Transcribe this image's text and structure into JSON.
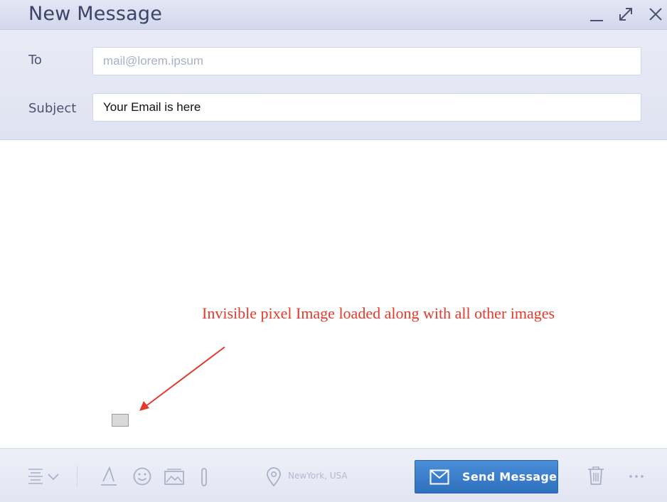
{
  "window": {
    "title": "New Message"
  },
  "form": {
    "to_label": "To",
    "to_value": "",
    "to_placeholder": "mail@lorem.ipsum",
    "subject_label": "Subject",
    "subject_value": "Your Email is here"
  },
  "annotation": {
    "text": "Invisible pixel Image loaded along with all other images",
    "color": "#e23b2e"
  },
  "toolbar": {
    "location_text": "NewYork, USA",
    "send_label": "Send Message",
    "icons": [
      "align-icon",
      "chevron-down-icon",
      "text-format-icon",
      "emoji-icon",
      "image-icon",
      "attach-icon",
      "location-pin-icon",
      "envelope-icon",
      "trash-icon",
      "more-icon"
    ]
  },
  "colors": {
    "send_button": "#3a7fcc",
    "header": "#e3e6f4"
  }
}
